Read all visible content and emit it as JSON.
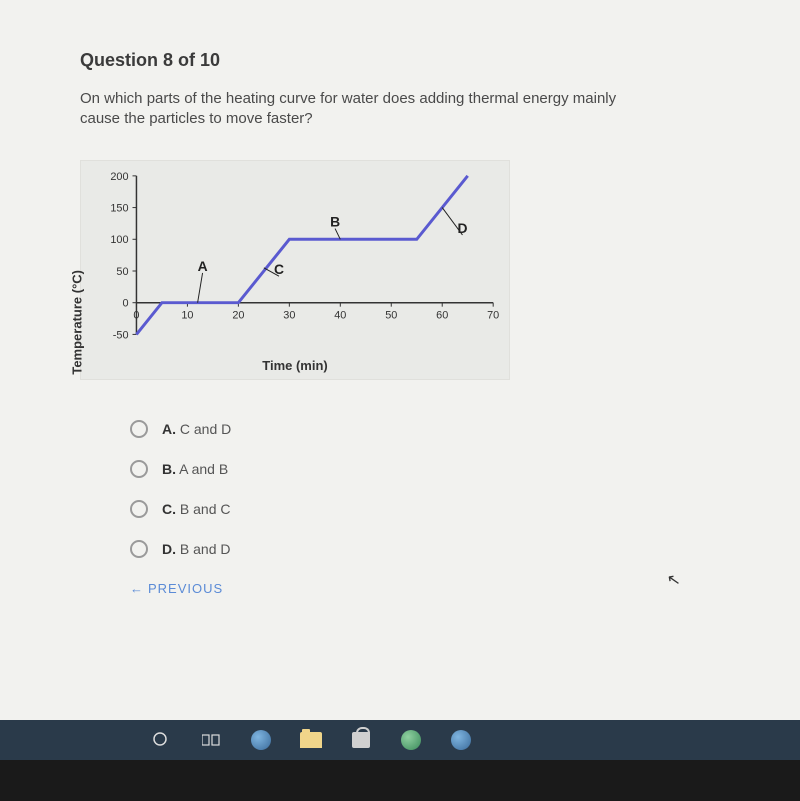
{
  "question": {
    "title": "Question 8 of 10",
    "text": "On which parts of the heating curve for water does adding thermal energy mainly cause the particles to move faster?"
  },
  "chart_data": {
    "type": "line",
    "xlabel": "Time (min)",
    "ylabel": "Temperature (°C)",
    "xlim": [
      0,
      70
    ],
    "ylim": [
      -50,
      200
    ],
    "x_ticks": [
      0,
      10,
      20,
      30,
      40,
      50,
      60,
      70
    ],
    "y_ticks": [
      -50,
      0,
      50,
      100,
      150,
      200
    ],
    "series": [
      {
        "name": "heating-curve",
        "points": [
          [
            0,
            -50
          ],
          [
            5,
            0
          ],
          [
            20,
            0
          ],
          [
            30,
            100
          ],
          [
            55,
            100
          ],
          [
            65,
            200
          ]
        ]
      }
    ],
    "annotations": [
      {
        "label": "A",
        "at": [
          12,
          50
        ]
      },
      {
        "label": "B",
        "at": [
          38,
          120
        ]
      },
      {
        "label": "C",
        "at": [
          27,
          45
        ]
      },
      {
        "label": "D",
        "at": [
          63,
          110
        ]
      }
    ]
  },
  "options": [
    {
      "letter": "A.",
      "text": "C and D"
    },
    {
      "letter": "B.",
      "text": "A and B"
    },
    {
      "letter": "C.",
      "text": "B and C"
    },
    {
      "letter": "D.",
      "text": "B and D"
    }
  ],
  "nav": {
    "previous": "PREVIOUS"
  }
}
